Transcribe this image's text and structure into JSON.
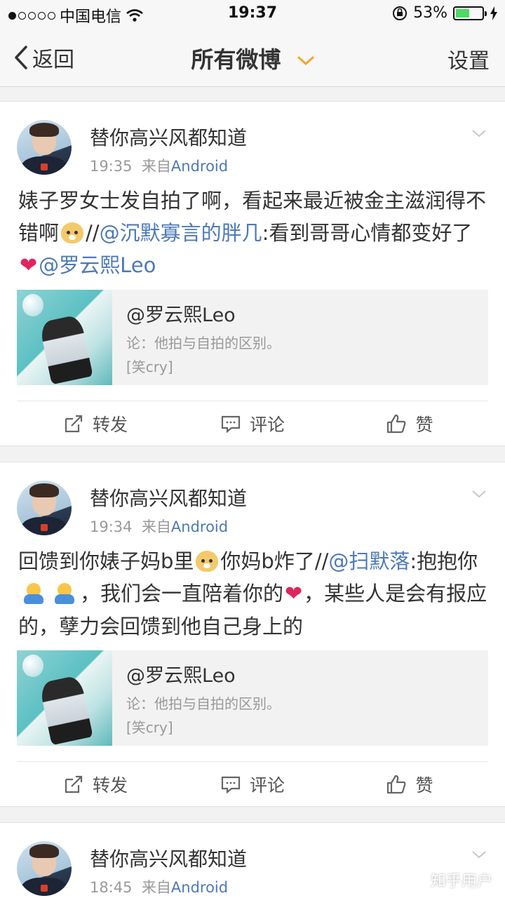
{
  "status_bar": {
    "carrier": "中国电信",
    "time": "19:37",
    "battery_pct": "53%",
    "signal_bars": 1
  },
  "nav": {
    "back_label": "返回",
    "title": "所有微博",
    "settings_label": "设置",
    "accent_color": "#f5a623"
  },
  "posts": [
    {
      "author": "替你高兴风都知道",
      "time": "19:35",
      "source_prefix": "来自",
      "source": "Android",
      "text": {
        "p1": "婊子罗女士发自拍了啊，看起来最近被金主滋润得不错啊",
        "p2": "//",
        "mention1": "@沉默寡言的胖几",
        "p3": ":看到哥哥心情都变好了",
        "mention2": "@罗云熙Leo"
      },
      "repost": {
        "title": "@罗云熙Leo",
        "subtitle": "论：他拍与自拍的区别。",
        "tag": "[笑cry]"
      }
    },
    {
      "author": "替你高兴风都知道",
      "time": "19:34",
      "source_prefix": "来自",
      "source": "Android",
      "text": {
        "p1": "回馈到你婊子妈b里",
        "p2": "你妈b炸了//",
        "mention1": "@扫默落",
        "p3": ":抱抱你",
        "p4": "，我们会一直陪着你的",
        "p5": "，某些人是会有报应的，孽力会回馈到他自己身上的"
      },
      "repost": {
        "title": "@罗云熙Leo",
        "subtitle": "论：他拍与自拍的区别。",
        "tag": "[笑cry]"
      }
    },
    {
      "author": "替你高兴风都知道",
      "time": "18:45",
      "source_prefix": "来自",
      "source": "Android"
    }
  ],
  "actions": {
    "repost": "转发",
    "comment": "评论",
    "like": "赞"
  },
  "link_color": "#4e79b8",
  "watermark": "知乎用户"
}
